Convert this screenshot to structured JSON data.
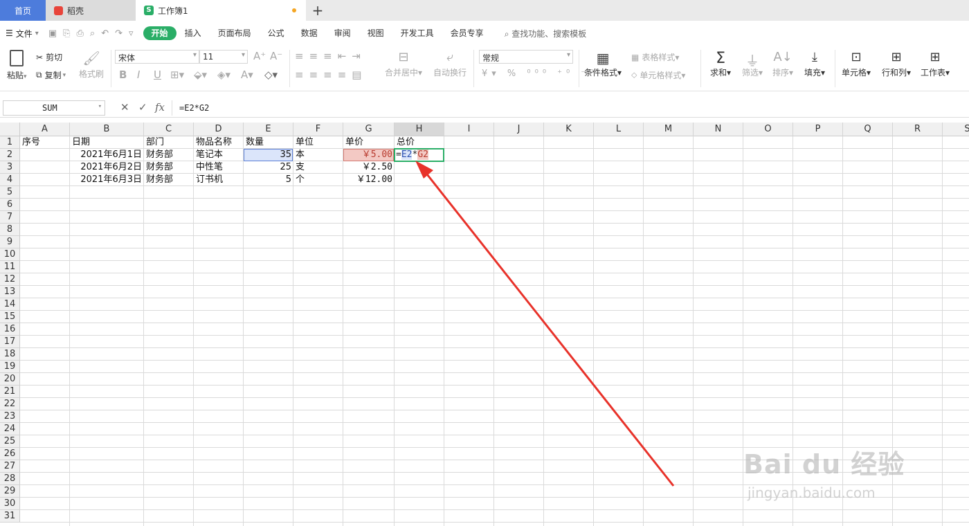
{
  "tabs": {
    "home": "首页",
    "daoke": "稻壳",
    "workbook": "工作簿1",
    "new_tab": "+"
  },
  "menu": {
    "file": "文件",
    "tabs": [
      "开始",
      "插入",
      "页面布局",
      "公式",
      "数据",
      "审阅",
      "视图",
      "开发工具",
      "会员专享"
    ],
    "search": "查找功能、搜索模板"
  },
  "ribbon": {
    "paste": "粘贴",
    "cut": "剪切",
    "copy": "复制",
    "format_painter": "格式刷",
    "font_name": "宋体",
    "font_size": "11",
    "merge_center": "合并居中",
    "wrap_text": "自动换行",
    "number_format": "常规",
    "conditional_format": "条件格式",
    "table_style": "表格样式",
    "cell_style": "单元格样式",
    "sum": "求和",
    "filter": "筛选",
    "sort": "排序",
    "fill": "填充",
    "cell": "单元格",
    "row_col": "行和列",
    "worksheet": "工作表"
  },
  "formula_bar": {
    "name_box": "SUM",
    "formula": "=E2*G2"
  },
  "sheet": {
    "columns": [
      "A",
      "B",
      "C",
      "D",
      "E",
      "F",
      "G",
      "H",
      "I",
      "J",
      "K",
      "L",
      "M",
      "N",
      "O",
      "P",
      "Q",
      "R",
      "S"
    ],
    "rows": [
      "1",
      "2",
      "3",
      "4",
      "5",
      "6",
      "7",
      "8",
      "9",
      "10",
      "11",
      "12",
      "13",
      "14",
      "15",
      "16",
      "17",
      "18",
      "19",
      "20",
      "21",
      "22",
      "23",
      "24",
      "25",
      "26",
      "27",
      "28",
      "29",
      "30",
      "31"
    ],
    "headers": {
      "A": "序号",
      "B": "日期",
      "C": "部门",
      "D": "物品名称",
      "E": "数量",
      "F": "单位",
      "G": "单价",
      "H": "总价"
    },
    "data": [
      {
        "B": "2021年6月1日",
        "C": "财务部",
        "D": "笔记本",
        "E": "35",
        "F": "本",
        "G": "￥5.00"
      },
      {
        "B": "2021年6月2日",
        "C": "财务部",
        "D": "中性笔",
        "E": "25",
        "F": "支",
        "G": "￥2.50"
      },
      {
        "B": "2021年6月3日",
        "C": "财务部",
        "D": "订书机",
        "E": "5",
        "F": "个",
        "G": "￥12.00"
      }
    ],
    "editing": {
      "cell": "H2",
      "prefix": "=",
      "ref1": "E2",
      "op": "*",
      "ref2": "G2"
    }
  },
  "watermark": {
    "brand": "Bai du 经验",
    "url": "jingyan.baidu.com"
  },
  "colors": {
    "accent": "#2aae67",
    "home_tab": "#4d7cdc",
    "ref_blue": "#5b7fd6",
    "ref_red": "#d47a72",
    "arrow": "#e8322a"
  }
}
